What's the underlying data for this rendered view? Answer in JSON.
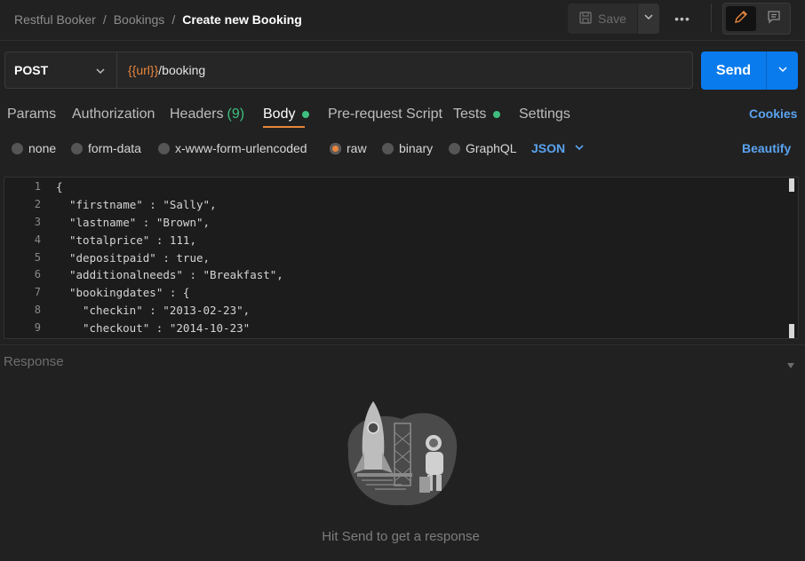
{
  "header": {
    "breadcrumbs": [
      "Restful Booker",
      "Bookings"
    ],
    "separator": "/",
    "current": "Create new Booking",
    "save_label": "Save",
    "more_label": "•••"
  },
  "request": {
    "method": "POST",
    "url_variable": "{{url}}",
    "url_path": "/booking",
    "send_label": "Send"
  },
  "tabs": {
    "params": "Params",
    "authorization": "Authorization",
    "headers": "Headers",
    "headers_count": "(9)",
    "body": "Body",
    "pre_request": "Pre-request Script",
    "tests": "Tests",
    "settings": "Settings",
    "cookies": "Cookies"
  },
  "body_types": {
    "none": "none",
    "form_data": "form-data",
    "urlencoded": "x-www-form-urlencoded",
    "raw": "raw",
    "binary": "binary",
    "graphql": "GraphQL",
    "format": "JSON",
    "beautify": "Beautify",
    "selected": "raw"
  },
  "editor": {
    "line_numbers": [
      "1",
      "2",
      "3",
      "4",
      "5",
      "6",
      "7",
      "8",
      "9"
    ],
    "lines": [
      "{",
      "\"firstname\" : \"Sally\",",
      "\"lastname\" : \"Brown\",",
      "\"totalprice\" : 111,",
      "\"depositpaid\" : true,",
      "\"additionalneeds\" : \"Breakfast\",",
      "\"bookingdates\" : {",
      "\"checkin\" : \"2013-02-23\",",
      "\"checkout\" : \"2014-10-23\""
    ]
  },
  "response": {
    "label": "Response",
    "empty_message": "Hit Send to get a response"
  },
  "colors": {
    "accent_orange": "#e8853c",
    "send_blue": "#097bed",
    "link_blue": "#5aa3f0",
    "status_green": "#3fbf7f"
  }
}
